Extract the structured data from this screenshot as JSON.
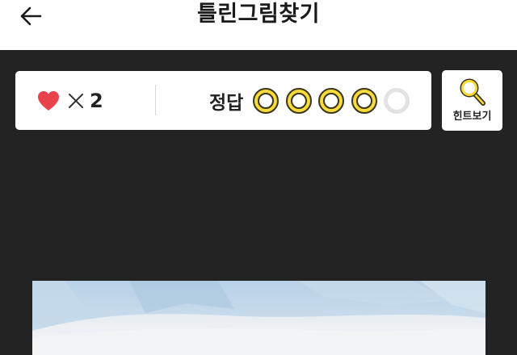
{
  "header": {
    "title": "틀린그림찾기",
    "back_icon": "arrow-left-icon"
  },
  "status": {
    "lives_icon": "heart-icon",
    "multiply_icon": "times-icon",
    "lives_count": "2",
    "answers_label": "정답",
    "answers_total": 5,
    "answers_found": 4,
    "heart_color": "#e8424a",
    "found_color": "#f7db3a",
    "empty_color": "#e2e2e2"
  },
  "hint": {
    "label": "힌트보기",
    "icon": "magnifier-icon"
  },
  "colors": {
    "background": "#232323",
    "header_bg": "#ffffff",
    "card_bg": "#ffffff"
  }
}
